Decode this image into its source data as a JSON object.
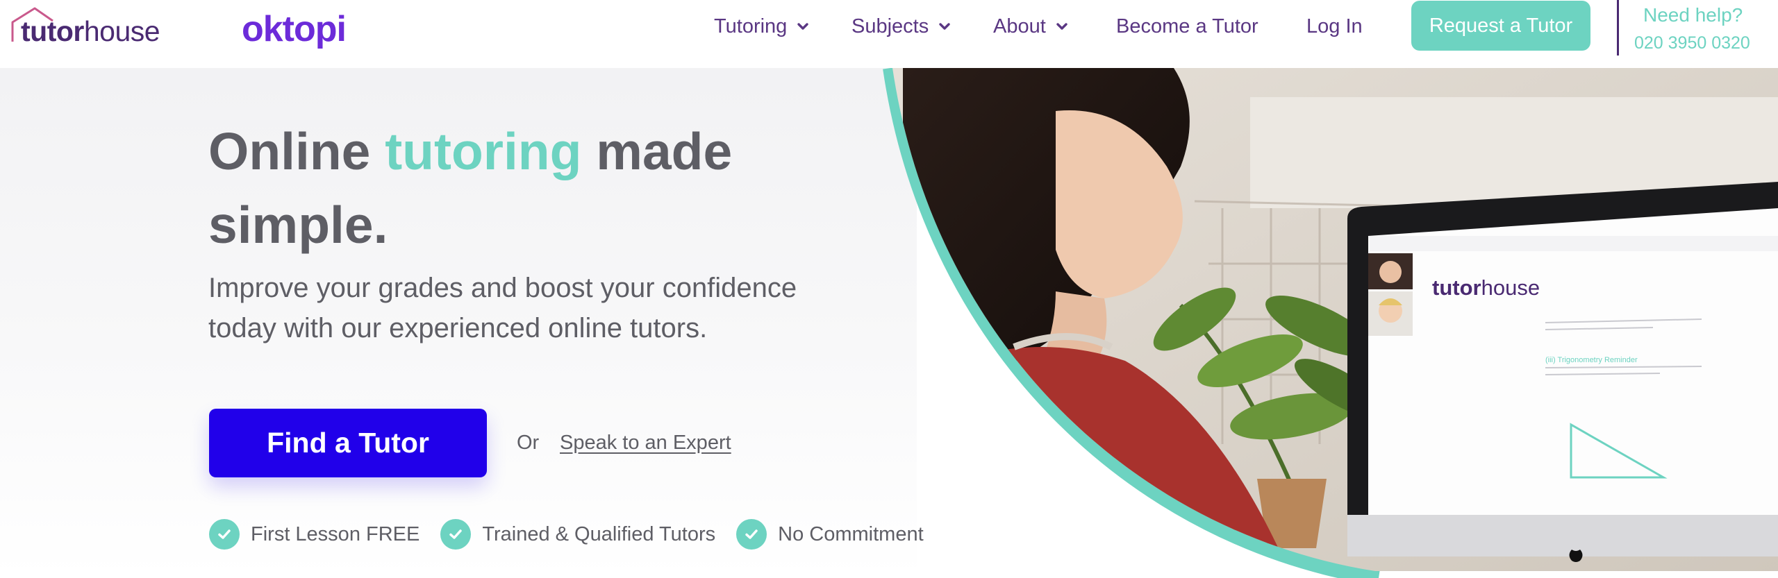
{
  "header": {
    "logo_primary_strong": "tutor",
    "logo_primary_light": "house",
    "logo_secondary": "oktopi",
    "nav": [
      {
        "label": "Tutoring",
        "has_dropdown": true
      },
      {
        "label": "Subjects",
        "has_dropdown": true
      },
      {
        "label": "About",
        "has_dropdown": true
      },
      {
        "label": "Become a Tutor",
        "has_dropdown": false
      },
      {
        "label": "Log In",
        "has_dropdown": false
      }
    ],
    "cta_label": "Request a Tutor",
    "help_title": "Need help?",
    "help_phone": "020 3950 0320"
  },
  "hero": {
    "headline_part1": "Online",
    "headline_accent": "tutoring",
    "headline_part2": "made simple.",
    "subtitle": "Improve your grades and boost your confidence today with our experienced online tutors.",
    "primary_button": "Find a Tutor",
    "or_text": "Or",
    "secondary_link": "Speak to an Expert",
    "features": [
      "First Lesson FREE",
      "Trained & Qualified Tutors",
      "No Commitment"
    ],
    "screen_logo_strong": "tutor",
    "screen_logo_light": "house",
    "screen_heading": "(iii) Trigonometry Reminder"
  },
  "icons": {
    "logo_house": "house-outline-icon",
    "dropdown": "chevron-down-icon",
    "feature_check": "check-circle-icon",
    "monitor_brand": "apple-logo-icon"
  },
  "colors": {
    "brand_purple": "#4a2a72",
    "nav_purple": "#5a3783",
    "oktopi_purple": "#6c2bd9",
    "teal_accent": "#6dd3c1",
    "primary_button": "#2100ea",
    "body_text": "#5e5e65"
  }
}
